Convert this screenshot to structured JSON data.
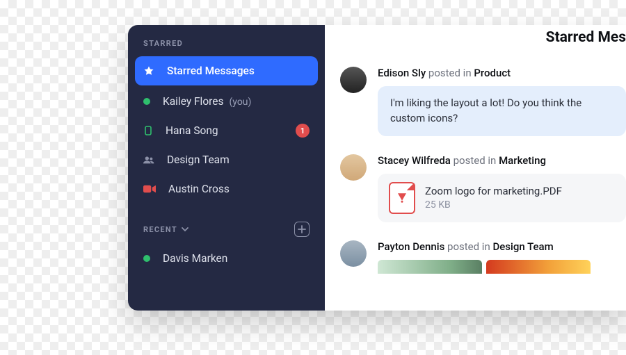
{
  "sidebar": {
    "starred": {
      "header": "STARRED",
      "items": [
        {
          "label": "Starred Messages"
        },
        {
          "label": "Kailey Flores",
          "you": "(you)"
        },
        {
          "label": "Hana Song",
          "unread": "1"
        },
        {
          "label": "Design Team"
        },
        {
          "label": "Austin Cross"
        }
      ]
    },
    "recent": {
      "header": "RECENT",
      "items": [
        {
          "label": "Davis Marken"
        }
      ]
    }
  },
  "main": {
    "title": "Starred Mes",
    "posts": [
      {
        "author": "Edison Sly",
        "verb": "posted in",
        "context": "Product",
        "bubble": "I'm liking the layout a lot! Do you think the custom icons?"
      },
      {
        "author": "Stacey Wilfreda",
        "verb": "posted in",
        "context": "Marketing",
        "file": {
          "name": "Zoom logo for marketing.PDF",
          "size": "25 KB"
        }
      },
      {
        "author": "Payton Dennis",
        "verb": "posted in",
        "context": "Design Team"
      }
    ]
  }
}
